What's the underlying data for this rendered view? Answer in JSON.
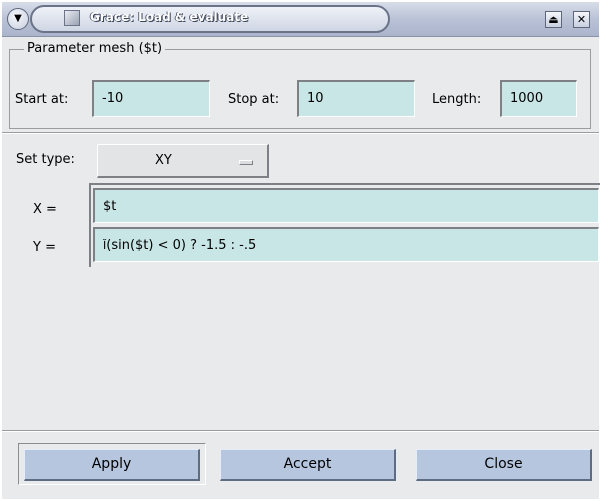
{
  "window": {
    "title": "Grace: Load & evaluate",
    "menu_icon": "down-arrow-icon",
    "maximize_icon": "eject-icon",
    "close_icon": "close-icon"
  },
  "parameter_mesh": {
    "legend": "Parameter mesh ($t)",
    "start_label": "Start at:",
    "start_value": "-10",
    "stop_label": "Stop at:",
    "stop_value": "10",
    "length_label": "Length:",
    "length_value": "1000"
  },
  "set_type": {
    "label": "Set type:",
    "value": "XY"
  },
  "expressions": {
    "x_label": "X =",
    "x_value": "$t",
    "y_label": "Y =",
    "y_value": "(sin($t) < 0) ? -1.5 : -.5"
  },
  "buttons": {
    "apply": "Apply",
    "accept": "Accept",
    "close": "Close"
  },
  "colors": {
    "field_bg": "#c8e6e6",
    "button_bg": "#b6c6df",
    "dialog_bg": "#e9eaeb"
  }
}
